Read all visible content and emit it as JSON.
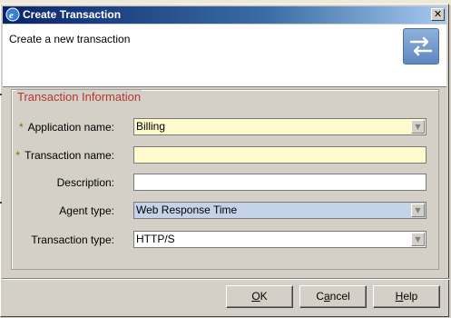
{
  "window": {
    "title": "Create Transaction",
    "close_glyph": "✕"
  },
  "header": {
    "text": "Create a new transaction",
    "icon": "transaction-arrows-icon"
  },
  "group": {
    "legend": "Transaction Information"
  },
  "fields": {
    "application_name": {
      "label": "Application name:",
      "value": "Billing",
      "required": true
    },
    "transaction_name": {
      "label": "Transaction name:",
      "value": "",
      "required": true
    },
    "description": {
      "label": "Description:",
      "value": ""
    },
    "agent_type": {
      "label": "Agent type:",
      "value": "Web Response Time"
    },
    "transaction_type": {
      "label": "Transaction type:",
      "value": "HTTP/S"
    }
  },
  "required_marker": "*",
  "buttons": {
    "ok": {
      "mnemonic": "O",
      "rest": "K"
    },
    "cancel": {
      "pre": "C",
      "mnemonic": "a",
      "rest": "ncel"
    },
    "help": {
      "mnemonic": "H",
      "rest": "elp"
    }
  },
  "colors": {
    "title_gradient_start": "#0a246a",
    "legend": "#b03a2e",
    "required_field_bg": "#fffbcc",
    "selected_combo_bg": "#c4d3e8"
  }
}
